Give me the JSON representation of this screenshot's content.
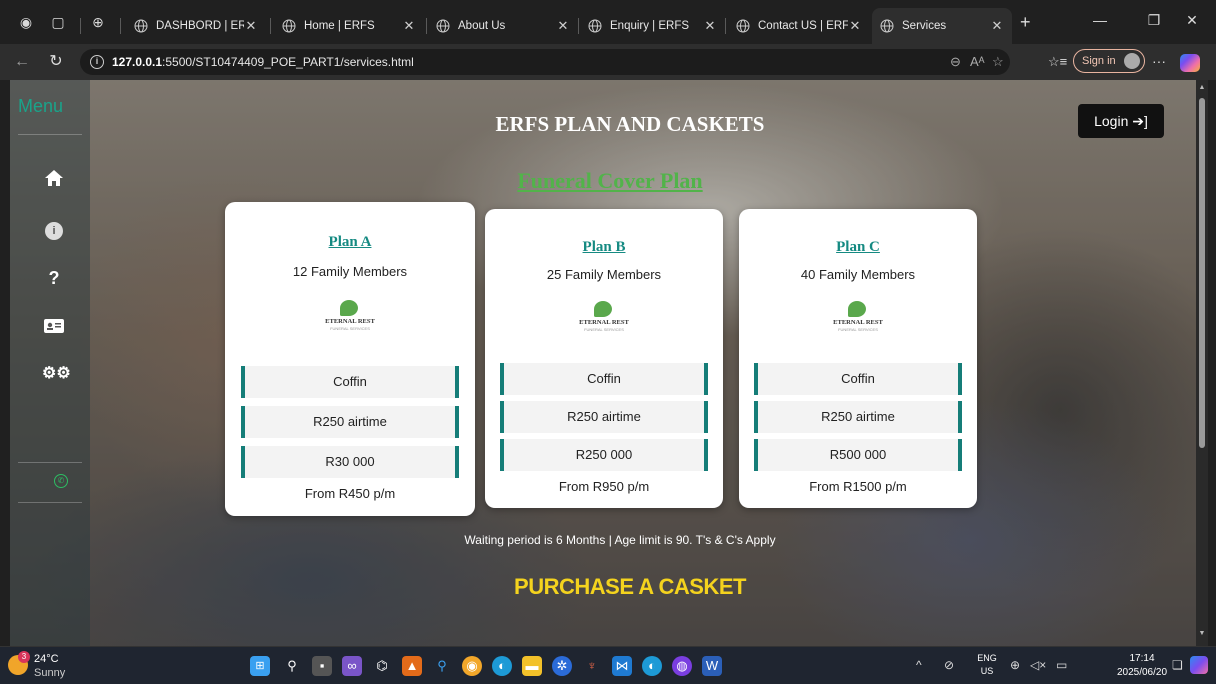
{
  "browser": {
    "tabs": [
      {
        "label": "DASHBORD | ERFS"
      },
      {
        "label": "Home | ERFS"
      },
      {
        "label": "About Us"
      },
      {
        "label": "Enquiry | ERFS"
      },
      {
        "label": "Contact US | ERFS"
      },
      {
        "label": "Services"
      }
    ],
    "url_host": "127.0.0.1",
    "url_rest": ":5500/ST10474409_POE_PART1/services.html",
    "sign_in": "Sign in"
  },
  "sidebar": {
    "title": "Menu",
    "icons": [
      "home-icon",
      "info-icon",
      "help-icon",
      "contact-card-icon",
      "settings-icon",
      "whatsapp-icon"
    ]
  },
  "page": {
    "heading": "ERFS PLAN AND CASKETS",
    "login": "Login",
    "plan_heading": "Funeral Cover Plan",
    "plans": [
      {
        "name": "Plan A",
        "members": "12 Family Members",
        "features": [
          "Coffin",
          "R250 airtime",
          "R30 000"
        ],
        "price": "From R450 p/m"
      },
      {
        "name": "Plan B",
        "members": "25 Family Members",
        "features": [
          "Coffin",
          "R250 airtime",
          "R250 000"
        ],
        "price": "From R950 p/m"
      },
      {
        "name": "Plan C",
        "members": "40 Family Members",
        "features": [
          "Coffin",
          "R250 airtime",
          "R500 000"
        ],
        "price": "From R1500 p/m"
      }
    ],
    "logo_text": "ETERNAL REST",
    "logo_sub": "FUNERAL SERVICES",
    "waiting": "Waiting period is 6 Months | Age limit is 90. T's & C's Apply",
    "purchase": "PURCHASE A CASKET"
  },
  "taskbar": {
    "temp": "24°C",
    "condition": "Sunny",
    "badge": "3",
    "lang1": "ENG",
    "lang2": "US",
    "time": "17:14",
    "date": "2025/06/20"
  },
  "colors": {
    "accent_teal": "#157d78",
    "plan_green": "#52b34a",
    "purchase_yellow": "#f4d31e"
  }
}
